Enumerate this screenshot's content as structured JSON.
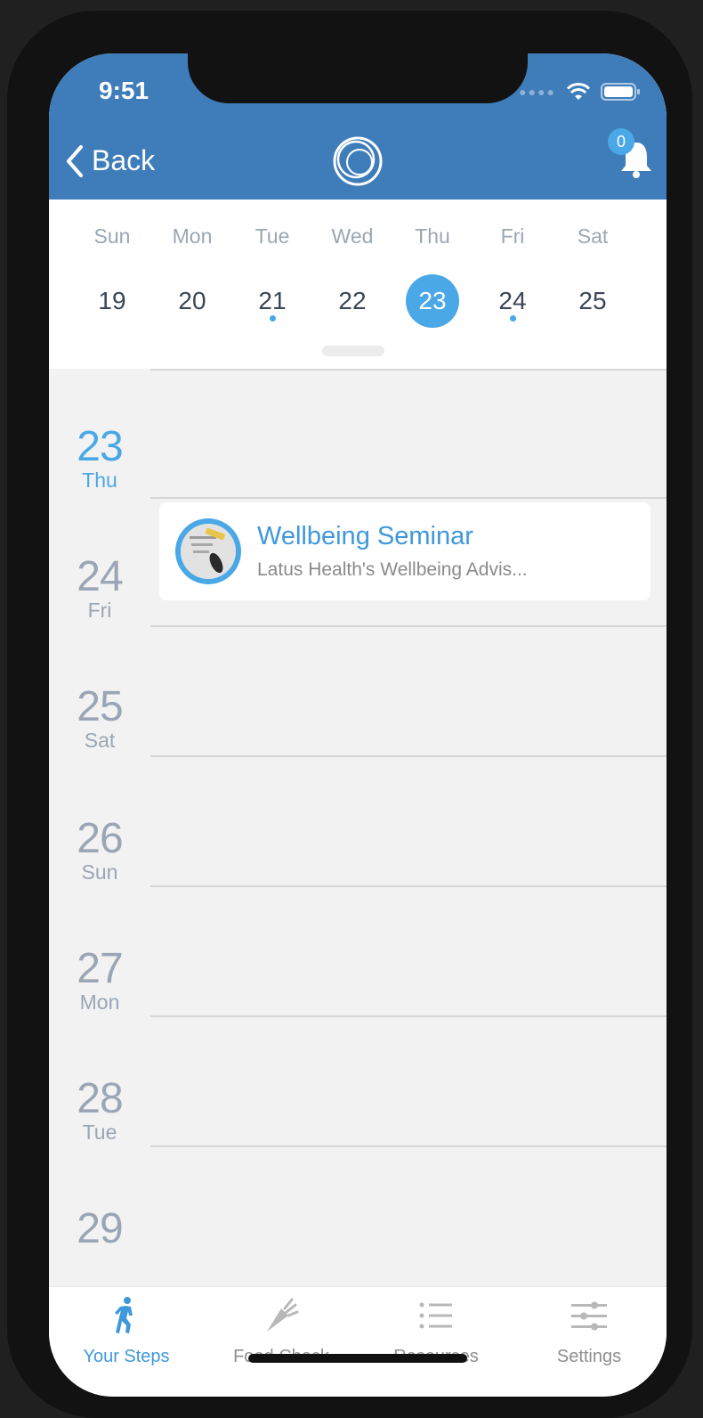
{
  "status_bar": {
    "time": "9:51"
  },
  "header": {
    "back_label": "Back",
    "notification_count": "0"
  },
  "week": {
    "days": [
      {
        "name": "Sun",
        "num": "19"
      },
      {
        "name": "Mon",
        "num": "20"
      },
      {
        "name": "Tue",
        "num": "21"
      },
      {
        "name": "Wed",
        "num": "22"
      },
      {
        "name": "Thu",
        "num": "23"
      },
      {
        "name": "Fri",
        "num": "24"
      },
      {
        "name": "Sat",
        "num": "25"
      }
    ]
  },
  "list": {
    "dates": [
      {
        "num": "23",
        "day": "Thu"
      },
      {
        "num": "24",
        "day": "Fri"
      },
      {
        "num": "25",
        "day": "Sat"
      },
      {
        "num": "26",
        "day": "Sun"
      },
      {
        "num": "27",
        "day": "Mon"
      },
      {
        "num": "28",
        "day": "Tue"
      },
      {
        "num": "29",
        "day": ""
      }
    ],
    "event": {
      "title": "Wellbeing Seminar",
      "subtitle": "Latus Health's Wellbeing Advis..."
    }
  },
  "tabs": [
    {
      "label": "Your Steps",
      "icon": "walking-icon"
    },
    {
      "label": "Food Check",
      "icon": "carrot-icon"
    },
    {
      "label": "Resources",
      "icon": "list-icon"
    },
    {
      "label": "Settings",
      "icon": "sliders-icon"
    }
  ],
  "colors": {
    "header": "#3f7dba",
    "accent": "#4aa8e7"
  }
}
